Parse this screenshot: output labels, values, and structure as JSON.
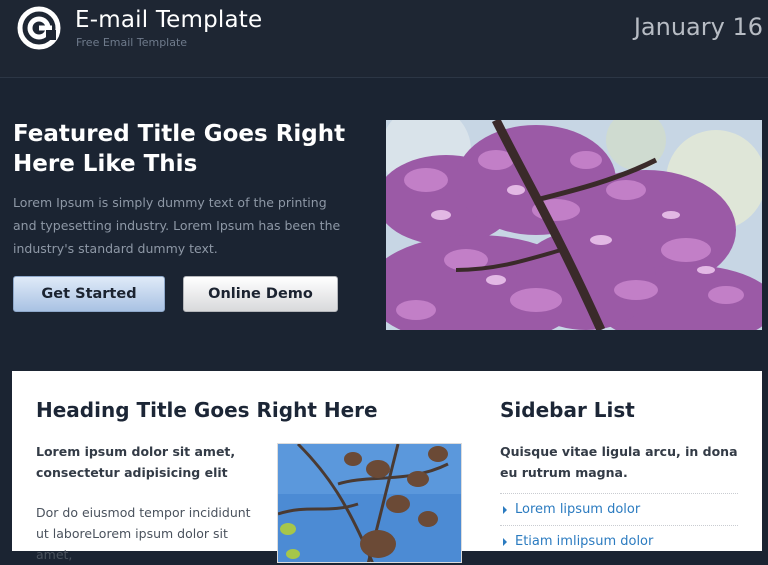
{
  "header": {
    "title": "E-mail Template",
    "subtitle": "Free Email Template",
    "date": "January 16",
    "logo_icon": "envelope-circle-logo-icon"
  },
  "hero": {
    "title": "Featured Title Goes Right Here Like This",
    "text": "Lorem Ipsum is simply dummy text of the printing and typesetting industry. Lorem Ipsum has been the industry's standard dummy text.",
    "primary_button": "Get Started",
    "secondary_button": "Online Demo",
    "image_subject": "purple redbud blossoms"
  },
  "main": {
    "heading": "Heading Title Goes Right Here",
    "lead": "Lorem ipsum dolor sit amet, consectetur adipisicing elit",
    "body": "Dor do eiusmod tempor incididunt ut laboreLorem ipsum dolor sit amet,",
    "image_subject": "tree branches against blue sky"
  },
  "sidebar": {
    "heading": "Sidebar List",
    "lead": "Quisque vitae ligula arcu, in dona eu rutrum magna.",
    "items": [
      {
        "label": "Lorem lipsum dolor"
      },
      {
        "label": "Etiam imlipsum dolor"
      }
    ]
  },
  "colors": {
    "background": "#1b2432",
    "header": "#1e2633",
    "link": "#2b7bc0",
    "card": "#ffffff"
  }
}
